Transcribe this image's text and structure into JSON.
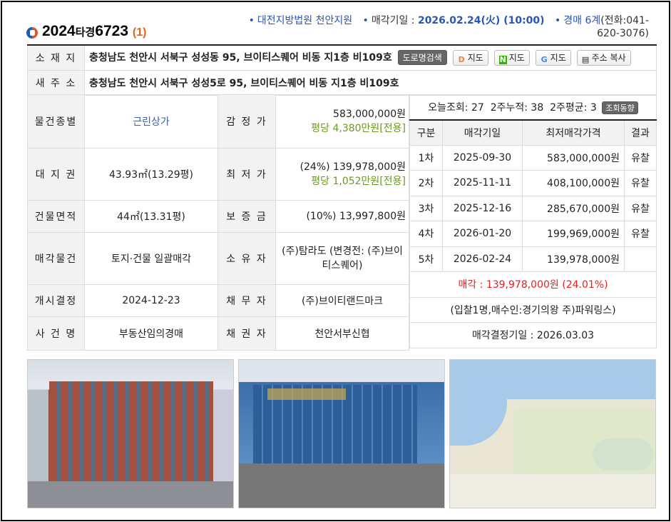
{
  "header": {
    "case_year": "2024",
    "case_type": "타경",
    "case_no": "6723",
    "item_count": "(1)",
    "court": "대전지방법원 천안지원",
    "sale_date_label": "매각기일 : ",
    "sale_date": "2026.02.24(火) (10:00)",
    "dept": "경매 6계",
    "phone": "(전화:041-620-3076)"
  },
  "address": {
    "label": "소 재 지",
    "value": "충청남도 천안시 서북구 성성동 95, 브이티스퀘어 비동 지1층 비109호",
    "buttons": [
      "도로명검색",
      "지도",
      "지도",
      "지도",
      "주소 복사"
    ],
    "new_label": "새 주 소",
    "new_value": "충청남도 천안시 서북구 성성5로 95, 브이티스퀘어 비동 지1층 비109호"
  },
  "details": {
    "type_label": "물건종별",
    "type": "근린상가",
    "appraisal_label": "감 정 가",
    "appraisal": "583,000,000원",
    "appraisal_pyeong": "평당 4,380만원[전용]",
    "land_label": "대 지 권",
    "land": "43.93㎡(13.29평)",
    "min_label": "최 저 가",
    "min_price": "(24%) 139,978,000원",
    "min_pyeong": "평당 1,052만원[전용]",
    "bldg_label": "건물면적",
    "bldg": "44㎡(13.31평)",
    "deposit_label": "보 증 금",
    "deposit": "(10%) 13,997,800원",
    "sale_obj_label": "매각물건",
    "sale_obj": "토지·건물 일괄매각",
    "owner_label": "소 유 자",
    "owner": "(주)탐라도 (변경전: (주)브이티스퀘어)",
    "start_label": "개시결정",
    "start": "2024-12-23",
    "debtor_label": "채 무 자",
    "debtor": "(주)브이티랜드마크",
    "case_name_label": "사 건 명",
    "case_name": "부동산임의경매",
    "creditor_label": "채 권 자",
    "creditor": "천안서부신협"
  },
  "stats": {
    "today": "오늘조회: 27",
    "two_week": "2주누적: 38",
    "avg": "2주평균: 3",
    "trend_btn": "조회동향"
  },
  "history": {
    "headers": [
      "구분",
      "매각기일",
      "최저매각가격",
      "결과"
    ],
    "rows": [
      [
        "1차",
        "2025-09-30",
        "583,000,000원",
        "유찰"
      ],
      [
        "2차",
        "2025-11-11",
        "408,100,000원",
        "유찰"
      ],
      [
        "3차",
        "2025-12-16",
        "285,670,000원",
        "유찰"
      ],
      [
        "4차",
        "2026-01-20",
        "199,969,000원",
        "유찰"
      ],
      [
        "5차",
        "2026-02-24",
        "139,978,000원",
        ""
      ]
    ],
    "sold_label": "매각 : ",
    "sold_price": "139,978,000원",
    "sold_pct": "(24.01%)",
    "bidders": "(입찰1명,매수인:경기의왕 주)파워링스)",
    "decision": "매각결정기일 : 2026.03.03"
  }
}
